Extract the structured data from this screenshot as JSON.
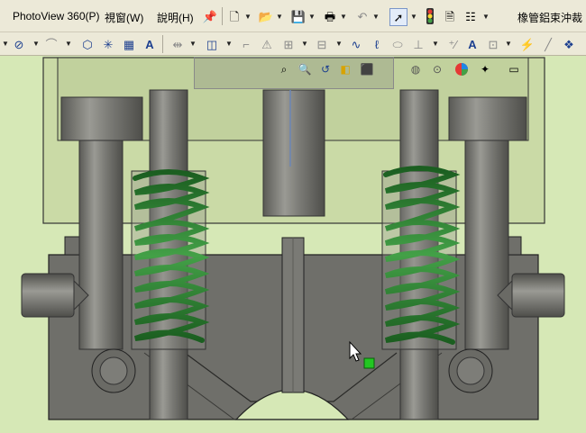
{
  "menubar": {
    "items": [
      {
        "label": "PhotoView 360(P)"
      },
      {
        "label": "視窗(W)"
      },
      {
        "label": "說明(H)"
      }
    ]
  },
  "document": {
    "title": "橡管鋁束沖裁"
  },
  "colors": {
    "background": "#d6e8b6",
    "toolbar": "#ece9d8",
    "spring": "#2e7d32",
    "part_gray": "#6e6e69",
    "transparent_plate": "#c9d6a3",
    "selection_marker": "#22c722"
  },
  "standard_toolbar": {
    "icons": [
      "pin-icon",
      "new-document-icon",
      "open-folder-icon",
      "save-icon",
      "print-icon",
      "undo-icon",
      "select-pointer-icon",
      "traffic-light-icon",
      "file-properties-icon",
      "options-icon"
    ]
  },
  "command_toolbar": {
    "icons": [
      "line-icon",
      "ellipse-icon",
      "fillet-icon",
      "polygon-icon",
      "point-icon",
      "grid-icon",
      "text-icon",
      "mirror-icon",
      "offset-icon",
      "trim-icon",
      "warning-icon",
      "smart-dimension-icon",
      "relations-icon",
      "curve-icon",
      "spline-icon",
      "ellipse-tool-icon",
      "dimension-icon",
      "text-tool-icon",
      "sketch-picture-icon",
      "settings-icon",
      "feature-icon",
      "layers-icon"
    ]
  },
  "heads_up_toolbar": {
    "icons": [
      "zoom-to-fit-icon",
      "zoom-area-icon",
      "previous-view-icon",
      "section-view-icon",
      "view-orientation-icon",
      "display-style-icon",
      "hide-show-icon",
      "edit-appearance-icon",
      "apply-scene-icon",
      "view-settings-icon"
    ]
  }
}
